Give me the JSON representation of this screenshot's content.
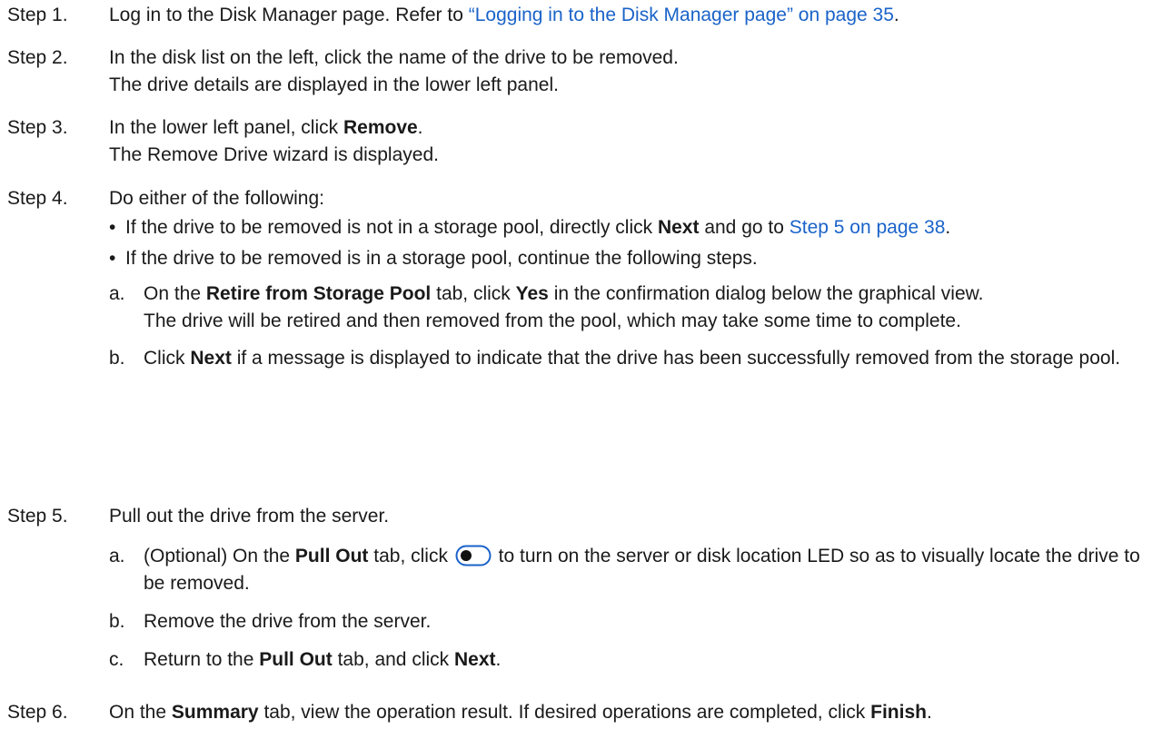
{
  "steps": [
    {
      "label": "Step 1.",
      "text_before": "Log in to the Disk Manager page. Refer to ",
      "link": "“Logging in to the Disk Manager page” on page 35",
      "text_after": "."
    },
    {
      "label": "Step 2.",
      "line1": "In the disk list on the left, click the name of the drive to be removed.",
      "line2": "The drive details are displayed in the lower left panel."
    },
    {
      "label": "Step 3.",
      "line1_before": "In the lower left panel, click ",
      "line1_bold": "Remove",
      "line1_after": ".",
      "line2": "The Remove Drive wizard is displayed."
    },
    {
      "label": "Step 4.",
      "intro": "Do either of the following:",
      "bullets": [
        {
          "dot": "•",
          "before": "If the drive to be removed is not in a storage pool, directly click ",
          "bold": "Next",
          "middle": " and go to ",
          "link": "Step 5 on page 38",
          "after": "."
        },
        {
          "dot": "•",
          "text": "If the drive to be removed is in a storage pool, continue the following steps."
        }
      ],
      "substeps": [
        {
          "letter": "a.",
          "t1": "On the ",
          "b1": "Retire from Storage Pool",
          "t2": " tab, click ",
          "b2": "Yes",
          "t3": " in the confirmation dialog below the graphical view.",
          "note": "The drive will be retired and then removed from the pool, which may take some time to complete."
        },
        {
          "letter": "b.",
          "t1": "Click ",
          "b1": "Next",
          "t2": " if a message is displayed to indicate that the drive has been successfully removed from the storage pool."
        }
      ]
    },
    {
      "label": "Step 5.",
      "intro": "Pull out the drive from the server.",
      "substeps": [
        {
          "letter": "a.",
          "t1": "(Optional) On the ",
          "b1": "Pull Out",
          "t2": " tab, click ",
          "icon": "toggle-switch-icon",
          "t3": " to turn on the server or disk location LED so as to visually locate the drive to be removed."
        },
        {
          "letter": "b.",
          "text": "Remove the drive from the server."
        },
        {
          "letter": "c.",
          "t1": "Return to the ",
          "b1": "Pull Out",
          "t2": " tab, and click ",
          "b2": "Next",
          "t3": "."
        }
      ]
    },
    {
      "label": "Step 6.",
      "t1": "On the ",
      "b1": "Summary",
      "t2": " tab, view the operation result. If desired operations are completed, click ",
      "b2": "Finish",
      "t3": "."
    }
  ],
  "colors": {
    "link": "#1a63c9",
    "text": "#1a1a1a"
  }
}
